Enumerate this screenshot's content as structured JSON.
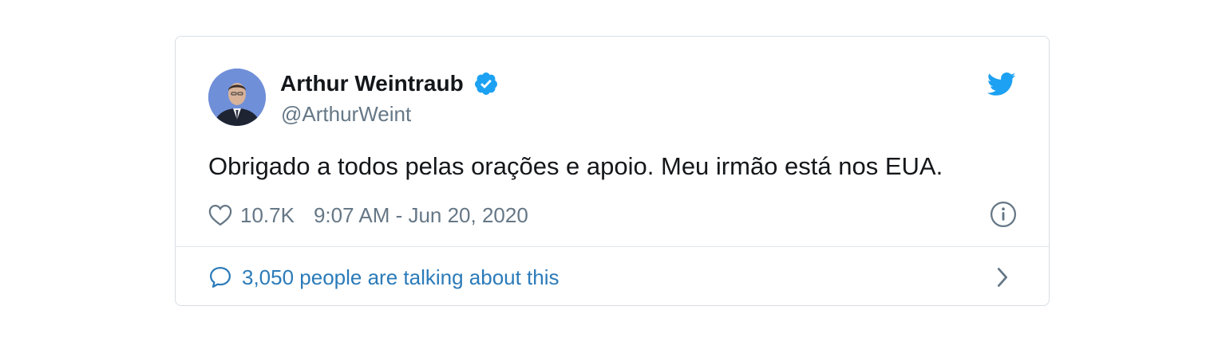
{
  "author": {
    "name": "Arthur Weintraub",
    "handle": "@ArthurWeint",
    "verified": true
  },
  "tweet": {
    "text": "Obrigado a todos pelas orações e apoio. Meu irmão está nos EUA."
  },
  "meta": {
    "likes": "10.7K",
    "timestamp": "9:07 AM - Jun 20, 2020"
  },
  "conversation": {
    "label": "3,050 people are talking about this"
  },
  "icons": {
    "avatar": "avatar",
    "verified": "verified-badge-icon",
    "logo": "twitter-bird-icon",
    "like": "heart-icon",
    "info": "info-icon",
    "reply": "speech-bubble-icon",
    "chevron": "chevron-right-icon"
  },
  "colors": {
    "brand": "#1da1f2",
    "link": "#2b7bb9",
    "muted": "#657786",
    "text": "#14171a",
    "border": "#d9dee3"
  }
}
